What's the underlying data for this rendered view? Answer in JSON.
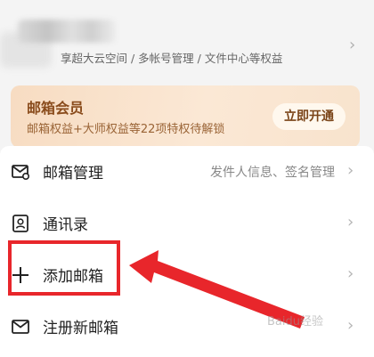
{
  "header": {
    "subtitle": "享超大云空间 / 多帐号管理 / 文件中心等权益"
  },
  "member_card": {
    "title": "邮箱会员",
    "subtitle": "邮箱权益+大师权益等22项特权待解锁",
    "button_label": "立即开通"
  },
  "menu": {
    "items": [
      {
        "label": "邮箱管理",
        "detail": "发件人信息、签名管理",
        "icon": "mail-settings-icon"
      },
      {
        "label": "通讯录",
        "icon": "contacts-icon"
      },
      {
        "label": "添加邮箱",
        "icon": "plus-icon"
      },
      {
        "label": "注册新邮箱",
        "icon": "mail-icon"
      }
    ]
  },
  "watermark": "Baidu经验",
  "colors": {
    "annotation_red": "#e8262b",
    "card_title": "#8a4c1c"
  }
}
